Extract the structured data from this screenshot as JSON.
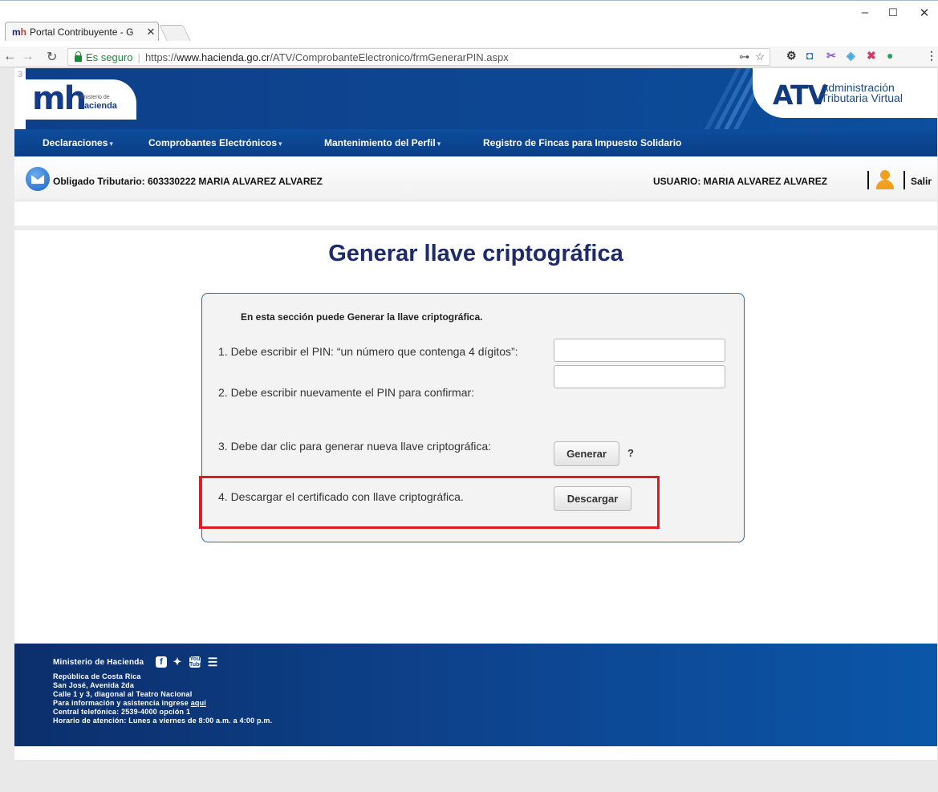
{
  "browser": {
    "tab_title": "Portal Contribuyente - G",
    "tab_favicon": "mh",
    "secure_label": "Es seguro",
    "url_scheme": "https://",
    "url_host": "www.hacienda.go.cr",
    "url_path": "/ATV/ComprobanteElectronico/frmGenerarPIN.aspx"
  },
  "banner": {
    "corner_number": "3",
    "logo_text": "mh",
    "logo_small": "Ministerio de",
    "logo_big": "Hacienda",
    "atv_logo": "ATV",
    "atv_line1": "Administración",
    "atv_line2": "Tributaria Virtual"
  },
  "menu": {
    "items": [
      {
        "label": "Declaraciones"
      },
      {
        "label": "Comprobantes Electrónicos"
      },
      {
        "label": "Mantenimiento del Perfil"
      },
      {
        "label": "Registro de Fincas para Impuesto Solidario"
      }
    ]
  },
  "userbar": {
    "obligado": "Obligado Tributario: 603330222 MARIA ALVAREZ ALVAREZ",
    "usuario": "USUARIO: MARIA ALVAREZ ALVAREZ",
    "salir": "Salir"
  },
  "main": {
    "title": "Generar llave criptográfica",
    "intro": "En esta sección puede Generar la llave criptográfica.",
    "step1": "1. Debe escribir el PIN: “un número que contenga 4 dígitos”:",
    "step2": "2. Debe escribir nuevamente el PIN para confirmar:",
    "step3": "3. Debe dar clic para generar nueva llave criptográfica:",
    "step4": "4. Descargar el certificado con llave criptográfica.",
    "generar_label": "Generar",
    "help": "?",
    "descargar_label": "Descargar",
    "pin_value": "",
    "pin_confirm_value": ""
  },
  "footer": {
    "org": "Ministerio de Hacienda",
    "lines": [
      "República de Costa Rica",
      "San José, Avenida 2da",
      "Calle 1 y 3, diagonal al Teatro Nacional",
      "Para información y asistencia ingrese",
      "Central telefónica: 2539-4000 opción 1",
      "Horario de atención: Lunes a viernes de 8:00 a.m. a 4:00 p.m."
    ],
    "link": "aquí",
    "youtube": "You Tube"
  },
  "colors": {
    "brand_blue": "#0d4793",
    "title_navy": "#1d2a6b",
    "highlight_red": "#e01a22",
    "secure_green": "#1a8a3a"
  }
}
